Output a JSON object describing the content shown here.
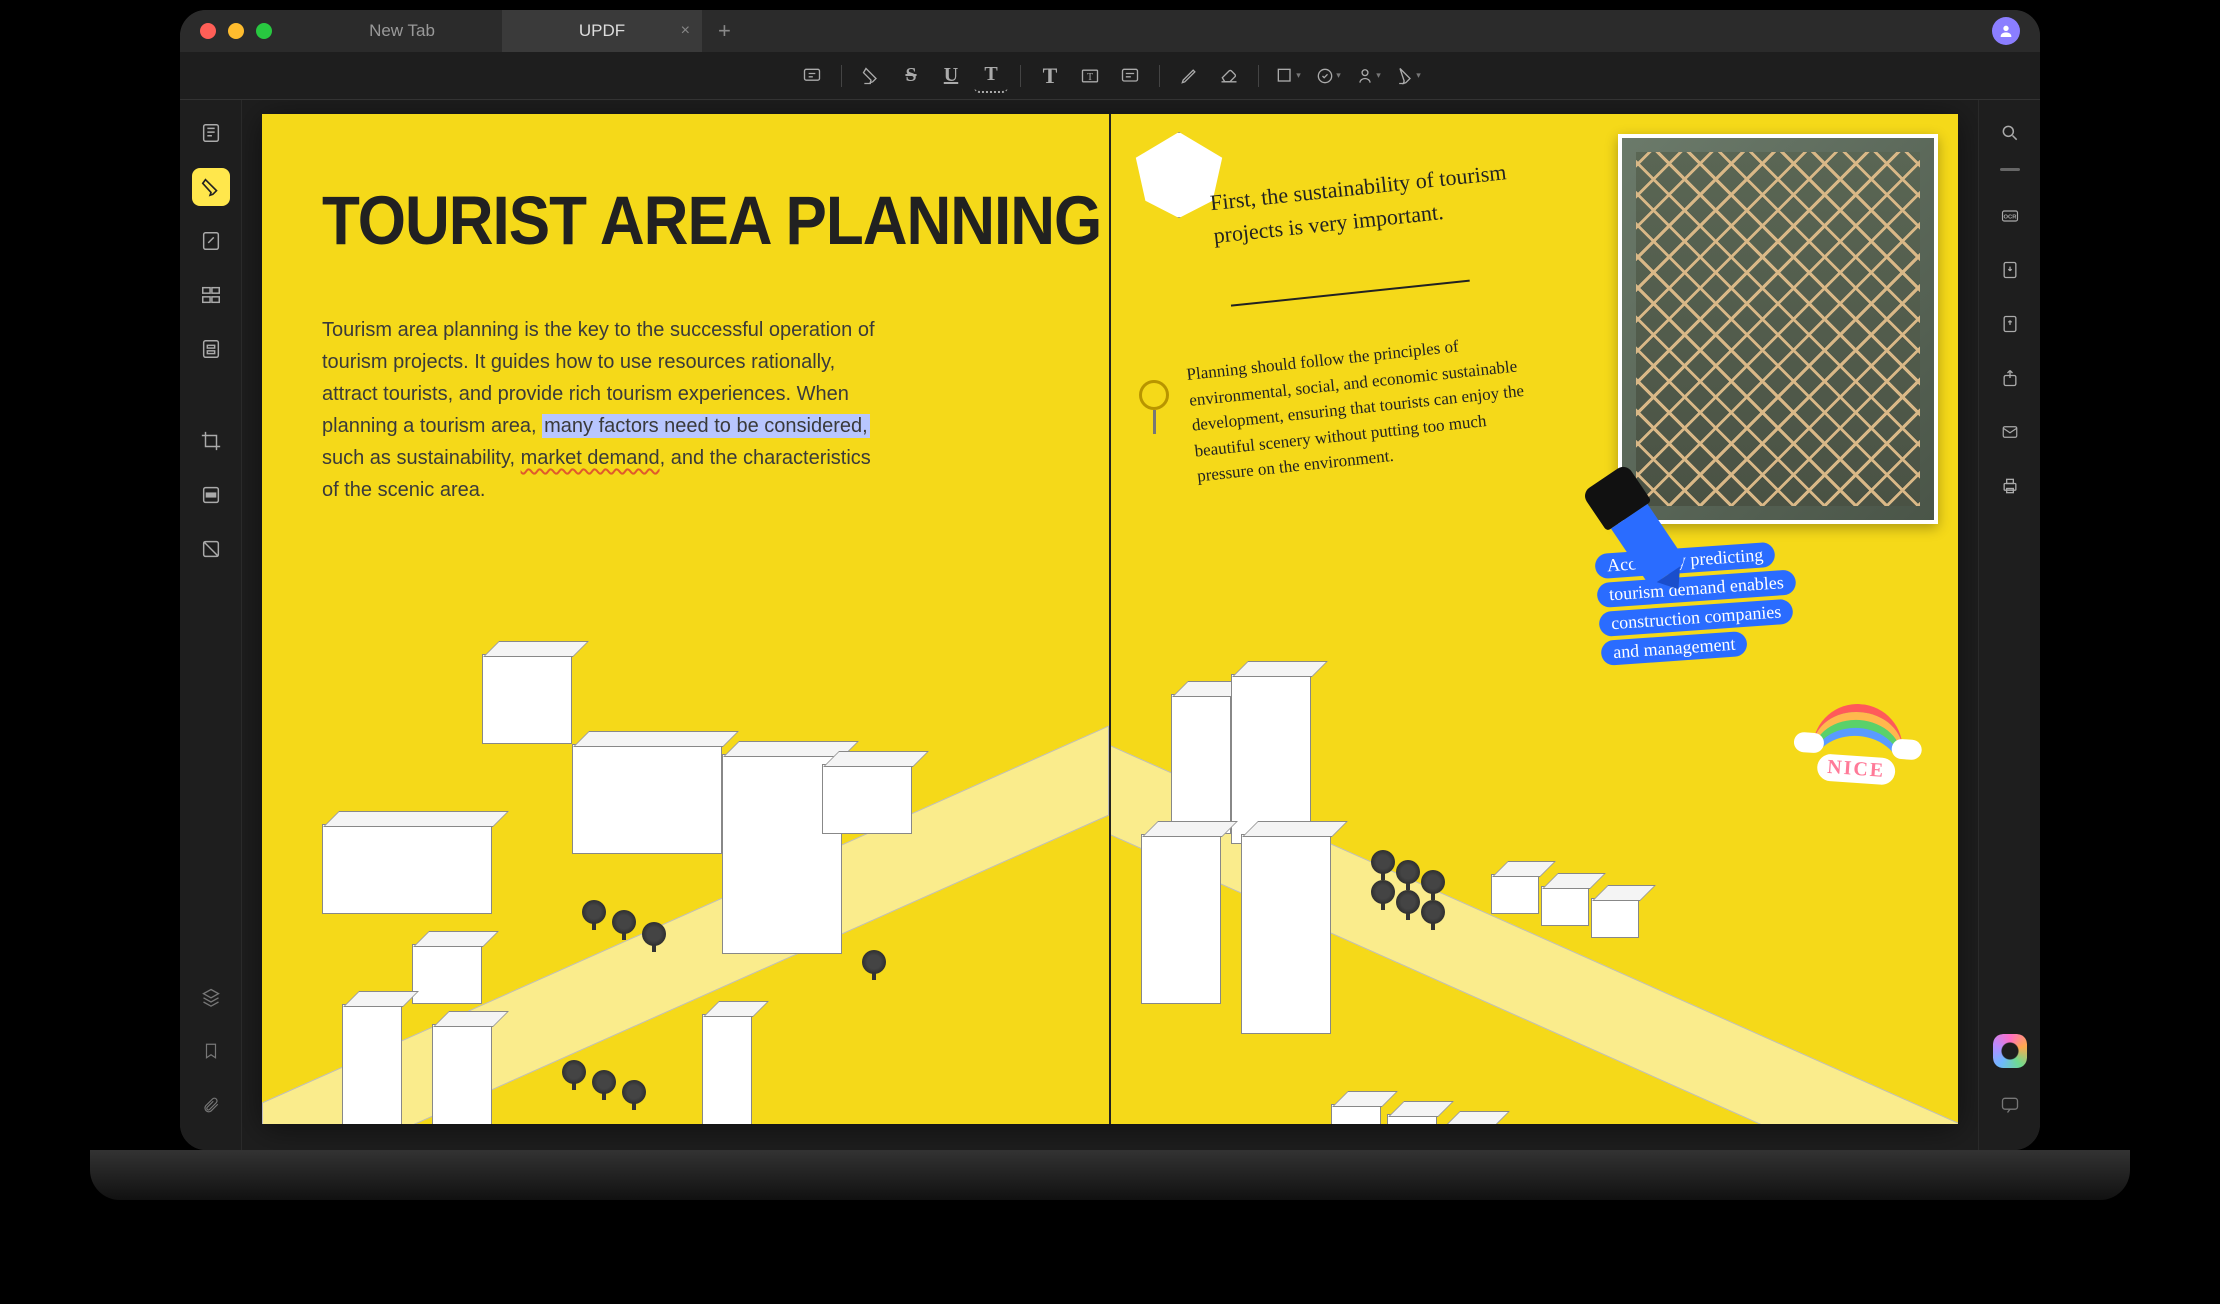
{
  "tabs": {
    "inactive_label": "New Tab",
    "active_label": "UPDF"
  },
  "document": {
    "title": "TOURIST AREA PLANNING",
    "body_prefix": "Tourism area planning is the key to the successful operation of tourism projects.  It guides how to use resources rationally, attract tourists, and provide rich tourism experiences. When planning a tourism area, ",
    "body_highlight": "many factors need to be considered,",
    "body_mid": " such as sustainability, ",
    "body_squiggle": "market demand",
    "body_suffix": ", and the characteristics of the scenic area."
  },
  "notes": {
    "first": "First, the sustainability of tourism projects is very important.",
    "second": "Planning should follow the principles of environmental, social, and economic sustainable development, ensuring that tourists can enjoy the beautiful scenery without putting too much pressure on the environment.",
    "marker1": "Accurately predicting",
    "marker2": "tourism demand enables",
    "marker3": "construction companies",
    "marker4": "and management"
  },
  "sticker": {
    "rainbow_label": "NICE"
  },
  "toolbar": {
    "comment": "comment",
    "highlight": "highlight",
    "strike": "strike",
    "underline": "underline",
    "text_markup": "text-markup",
    "text": "text",
    "textbox": "textbox",
    "note": "note",
    "pencil": "pencil",
    "eraser": "eraser",
    "shape": "shape",
    "stamp": "stamp",
    "signature": "signature",
    "sticker": "sticker"
  },
  "left_sidebar": {
    "reader": "reader",
    "annotate": "annotate",
    "edit": "edit",
    "organize": "organize",
    "form": "form",
    "crop": "crop",
    "redact": "redact",
    "ocr": "ocr",
    "layers": "layers",
    "bookmarks": "bookmarks",
    "attachments": "attachments"
  },
  "right_sidebar": {
    "search": "search",
    "ocr_export": "ocr-export",
    "convert": "convert",
    "export": "export",
    "share": "share",
    "email": "email",
    "print": "print",
    "ai": "ai",
    "chat": "chat"
  }
}
